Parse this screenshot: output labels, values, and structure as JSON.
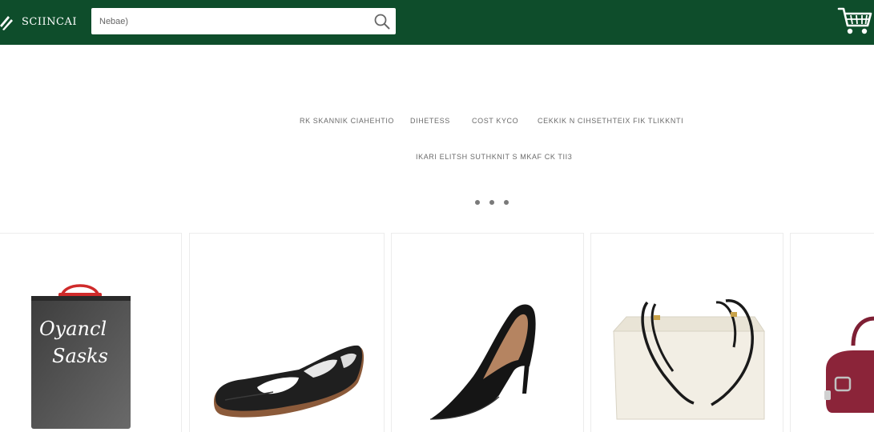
{
  "header": {
    "logo_text": "SCIINCAI",
    "search_placeholder": "Nebae)",
    "icons": {
      "search": "search-icon",
      "cart": "cart-icon",
      "logo": "logo-icon"
    },
    "colors": {
      "header_bg": "#0e4d2b"
    }
  },
  "nav": {
    "categories": [
      {
        "label": "RK SKANNIK CIAHEHTIO"
      },
      {
        "label": "DIHETESS"
      },
      {
        "label": "COST KYCO"
      },
      {
        "label": "CEKKIK N CIHSETHTEIX FIK TLIKKNTI"
      }
    ],
    "sub_label": "IKARI ELITSH SUTHKNIT S MKAF CK TII3",
    "carousel_dots": 3
  },
  "products": [
    {
      "image": "gift-bag-icon",
      "bag_script": "Oyancl Sasks"
    },
    {
      "image": "loafer-shoe-icon"
    },
    {
      "image": "high-heel-icon"
    },
    {
      "image": "tote-bag-icon"
    },
    {
      "image": "handbag-icon"
    }
  ]
}
